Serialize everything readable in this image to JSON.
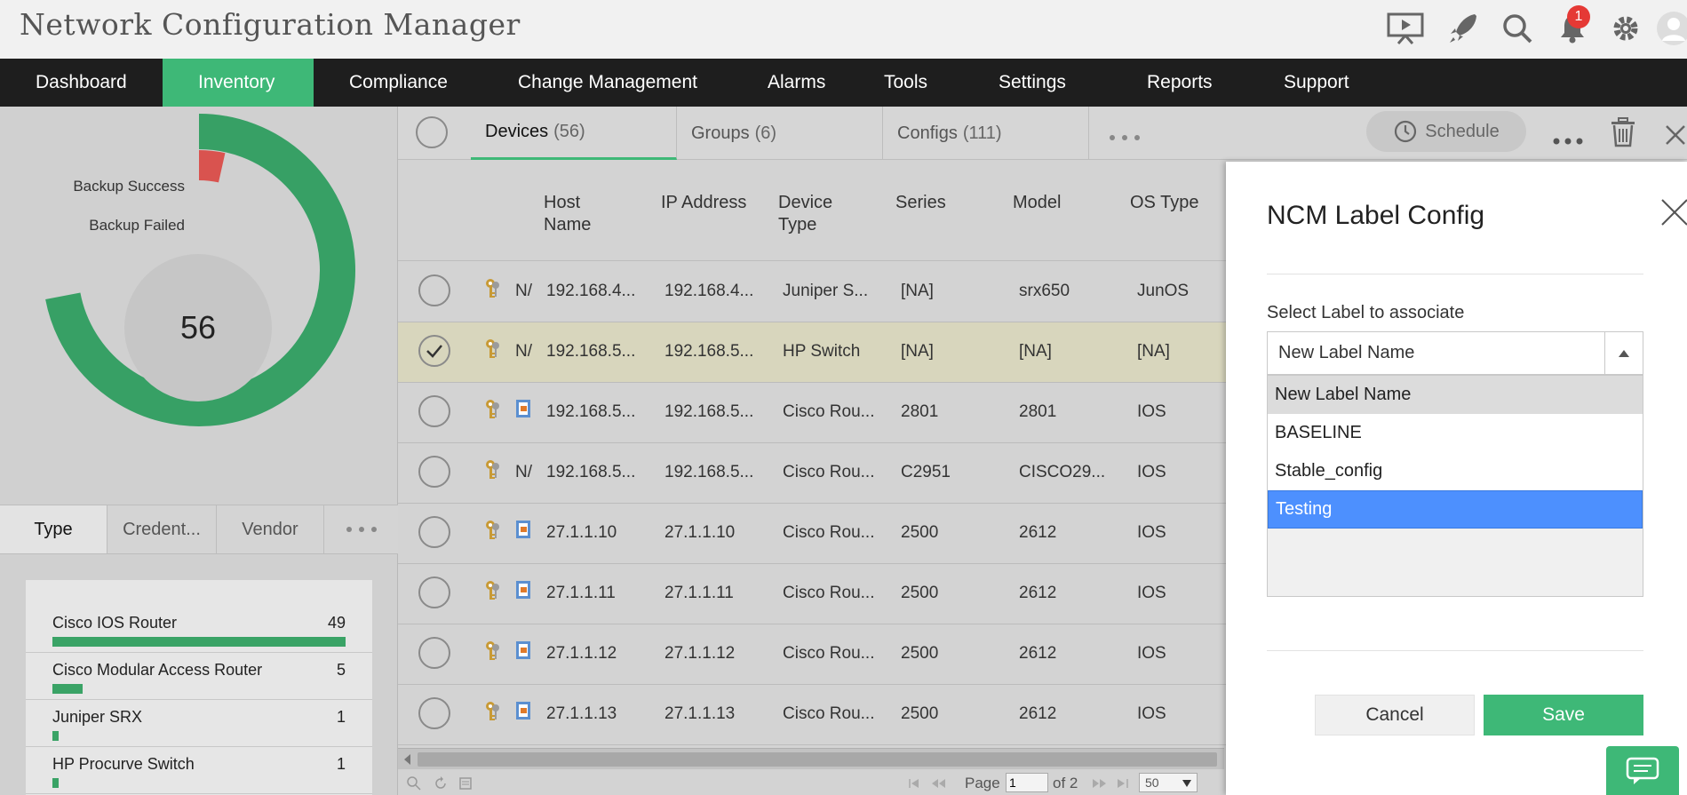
{
  "app": {
    "title": "Network Configuration Manager",
    "notification_count": "1"
  },
  "nav": {
    "items": [
      "Dashboard",
      "Inventory",
      "Compliance",
      "Change Management",
      "Alarms",
      "Tools",
      "Settings",
      "Reports",
      "Support"
    ],
    "active": "Inventory"
  },
  "donut": {
    "labels": [
      "Backup Success",
      "Backup Failed"
    ],
    "total": "56",
    "success_fraction": 0.946,
    "failed_fraction": 0.054
  },
  "left_tabs": [
    "Type",
    "Credent...",
    "Vendor"
  ],
  "type_list": [
    {
      "name": "Cisco IOS Router",
      "count": "49",
      "fraction": 1.0
    },
    {
      "name": "Cisco Modular Access Router",
      "count": "5",
      "fraction": 0.102
    },
    {
      "name": "Juniper SRX",
      "count": "1",
      "fraction": 0.02
    },
    {
      "name": "HP Procurve Switch",
      "count": "1",
      "fraction": 0.02
    }
  ],
  "main_tabs": [
    {
      "label": "Devices",
      "count": "(56)"
    },
    {
      "label": "Groups",
      "count": "(6)"
    },
    {
      "label": "Configs",
      "count": "(111)"
    }
  ],
  "toolbar": {
    "schedule": "Schedule"
  },
  "columns": [
    "Host\nName",
    "IP Address",
    "Device\nType",
    "Series",
    "Model",
    "OS Type"
  ],
  "rows": [
    {
      "prefix": "N/",
      "host": "192.168.4...",
      "ip": "192.168.4...",
      "type": "Juniper S...",
      "series": "[NA]",
      "model": "srx650",
      "os": "JunOS",
      "selected": false,
      "doc_icon": false
    },
    {
      "prefix": "N/",
      "host": "192.168.5...",
      "ip": "192.168.5...",
      "type": "HP Switch",
      "series": "[NA]",
      "model": "[NA]",
      "os": "[NA]",
      "selected": true,
      "doc_icon": false
    },
    {
      "prefix": "",
      "host": "192.168.5...",
      "ip": "192.168.5...",
      "type": "Cisco Rou...",
      "series": "2801",
      "model": "2801",
      "os": "IOS",
      "selected": false,
      "doc_icon": true
    },
    {
      "prefix": "N/",
      "host": "192.168.5...",
      "ip": "192.168.5...",
      "type": "Cisco Rou...",
      "series": "C2951",
      "model": "CISCO29...",
      "os": "IOS",
      "selected": false,
      "doc_icon": false
    },
    {
      "prefix": "",
      "host": "27.1.1.10",
      "ip": "27.1.1.10",
      "type": "Cisco Rou...",
      "series": "2500",
      "model": "2612",
      "os": "IOS",
      "selected": false,
      "doc_icon": true
    },
    {
      "prefix": "",
      "host": "27.1.1.11",
      "ip": "27.1.1.11",
      "type": "Cisco Rou...",
      "series": "2500",
      "model": "2612",
      "os": "IOS",
      "selected": false,
      "doc_icon": true
    },
    {
      "prefix": "",
      "host": "27.1.1.12",
      "ip": "27.1.1.12",
      "type": "Cisco Rou...",
      "series": "2500",
      "model": "2612",
      "os": "IOS",
      "selected": false,
      "doc_icon": true
    },
    {
      "prefix": "",
      "host": "27.1.1.13",
      "ip": "27.1.1.13",
      "type": "Cisco Rou...",
      "series": "2500",
      "model": "2612",
      "os": "IOS",
      "selected": false,
      "doc_icon": true
    }
  ],
  "pager": {
    "page_label": "Page",
    "page_value": "1",
    "of_label": "of 2",
    "per_page": "50"
  },
  "dialog": {
    "title": "NCM Label Config",
    "field_label": "Select Label to associate",
    "selected_value": "New Label Name",
    "options": [
      "New Label Name",
      "BASELINE",
      "Stable_config",
      "Testing"
    ],
    "highlighted": "Testing",
    "cancel": "Cancel",
    "save": "Save"
  },
  "colors": {
    "accent": "#3eb877",
    "nav_bg": "#1e1e1e",
    "failed": "#d9534f",
    "highlight": "#4d90fe"
  }
}
